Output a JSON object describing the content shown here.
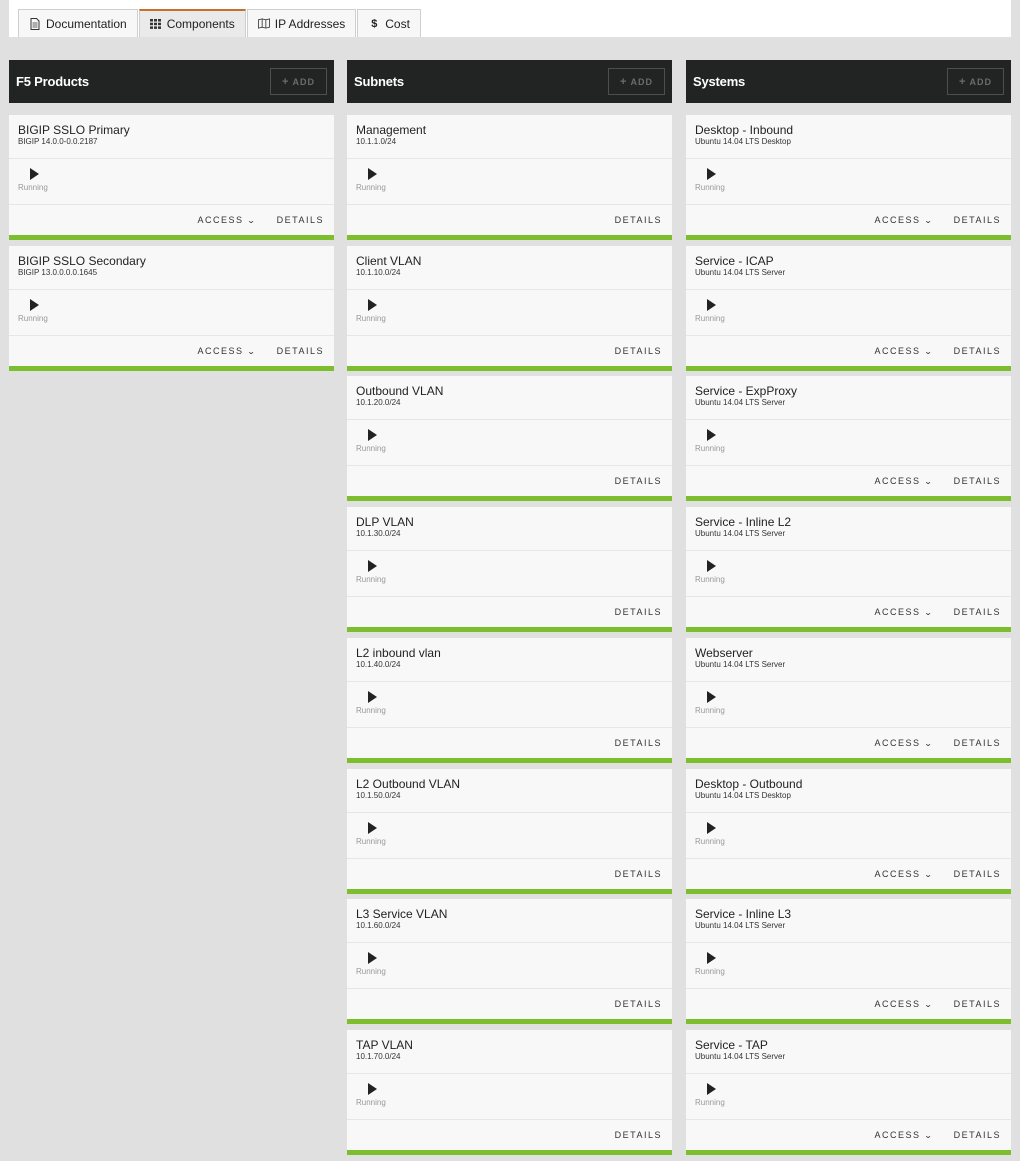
{
  "tabs": [
    {
      "label": "Documentation",
      "icon": "document-icon",
      "active": false
    },
    {
      "label": "Components",
      "icon": "grid-icon",
      "active": true
    },
    {
      "label": "IP Addresses",
      "icon": "map-icon",
      "active": false
    },
    {
      "label": "Cost",
      "icon": "dollar-icon",
      "active": false
    }
  ],
  "add_label": "ADD",
  "access_label": "ACCESS",
  "details_label": "DETAILS",
  "status_label": "Running",
  "colors": {
    "accent_tab": "#c8702a",
    "card_bar": "#7dbe2e",
    "header": "#222423"
  },
  "columns": [
    {
      "title": "F5 Products",
      "cards": [
        {
          "title": "BIGIP SSLO Primary",
          "subtitle": "BIGIP 14.0.0-0.0.2187",
          "access": true
        },
        {
          "title": "BIGIP SSLO Secondary",
          "subtitle": "BIGIP 13.0.0.0.0.1645",
          "access": true
        }
      ]
    },
    {
      "title": "Subnets",
      "cards": [
        {
          "title": "Management",
          "subtitle": "10.1.1.0/24",
          "access": false
        },
        {
          "title": "Client VLAN",
          "subtitle": "10.1.10.0/24",
          "access": false
        },
        {
          "title": "Outbound VLAN",
          "subtitle": "10.1.20.0/24",
          "access": false
        },
        {
          "title": "DLP VLAN",
          "subtitle": "10.1.30.0/24",
          "access": false
        },
        {
          "title": "L2 inbound vlan",
          "subtitle": "10.1.40.0/24",
          "access": false
        },
        {
          "title": "L2 Outbound VLAN",
          "subtitle": "10.1.50.0/24",
          "access": false
        },
        {
          "title": "L3 Service VLAN",
          "subtitle": "10.1.60.0/24",
          "access": false
        },
        {
          "title": "TAP VLAN",
          "subtitle": "10.1.70.0/24",
          "access": false
        }
      ]
    },
    {
      "title": "Systems",
      "cards": [
        {
          "title": "Desktop - Inbound",
          "subtitle": "Ubuntu 14.04 LTS Desktop",
          "access": true
        },
        {
          "title": "Service - ICAP",
          "subtitle": "Ubuntu 14.04 LTS Server",
          "access": true
        },
        {
          "title": "Service - ExpProxy",
          "subtitle": "Ubuntu 14.04 LTS Server",
          "access": true
        },
        {
          "title": "Service - Inline L2",
          "subtitle": "Ubuntu 14.04 LTS Server",
          "access": true
        },
        {
          "title": "Webserver",
          "subtitle": "Ubuntu 14.04 LTS Server",
          "access": true
        },
        {
          "title": "Desktop - Outbound",
          "subtitle": "Ubuntu 14.04 LTS Desktop",
          "access": true
        },
        {
          "title": "Service - Inline L3",
          "subtitle": "Ubuntu 14.04 LTS Server",
          "access": true
        },
        {
          "title": "Service - TAP",
          "subtitle": "Ubuntu 14.04 LTS Server",
          "access": true
        }
      ]
    }
  ]
}
